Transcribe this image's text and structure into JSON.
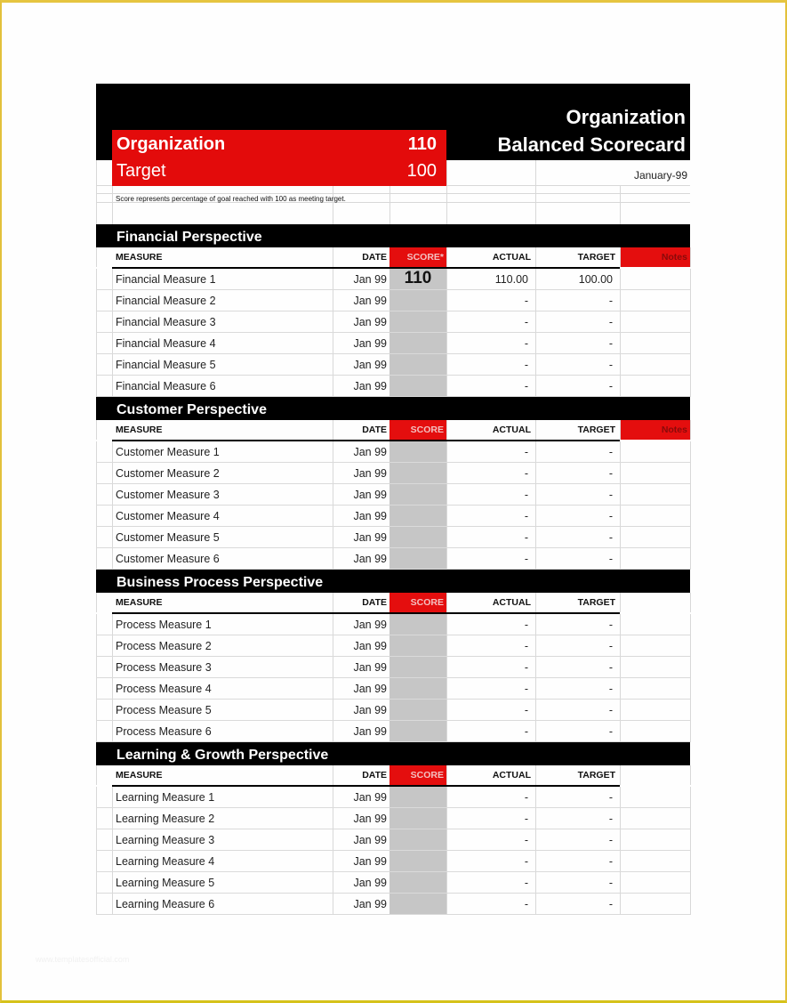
{
  "header": {
    "title_line1": "Organization",
    "title_line2": "Balanced Scorecard",
    "date": "January-99",
    "summary": [
      {
        "label": "Organization",
        "value": "110"
      },
      {
        "label": "Target",
        "value": "100"
      }
    ],
    "note": "Score represents percentage of goal reached with 100 as meeting target."
  },
  "colors": {
    "accent_red": "#e30b0b",
    "band_black": "#000000",
    "score_fill": "#c6c6c6",
    "frame_yellow": "#e3c13b"
  },
  "columns": {
    "measure": "MEASURE",
    "date": "DATE",
    "score": "SCORE",
    "score_first": "SCORE*",
    "actual": "ACTUAL",
    "target": "TARGET",
    "notes": "Notes"
  },
  "sections": [
    {
      "title": "Financial Perspective",
      "score_header": "SCORE*",
      "has_notes": true,
      "rows": [
        {
          "measure": "Financial Measure 1",
          "date": "Jan 99",
          "score": "110",
          "actual": "110.00",
          "target": "100.00"
        },
        {
          "measure": "Financial Measure 2",
          "date": "Jan 99",
          "score": "",
          "actual": "-",
          "target": "-"
        },
        {
          "measure": "Financial Measure 3",
          "date": "Jan 99",
          "score": "",
          "actual": "-",
          "target": "-"
        },
        {
          "measure": "Financial Measure 4",
          "date": "Jan 99",
          "score": "",
          "actual": "-",
          "target": "-"
        },
        {
          "measure": "Financial Measure 5",
          "date": "Jan 99",
          "score": "",
          "actual": "-",
          "target": "-"
        },
        {
          "measure": "Financial Measure 6",
          "date": "Jan 99",
          "score": "",
          "actual": "-",
          "target": "-"
        }
      ]
    },
    {
      "title": "Customer Perspective",
      "score_header": "SCORE",
      "has_notes": true,
      "rows": [
        {
          "measure": "Customer Measure 1",
          "date": "Jan 99",
          "score": "",
          "actual": "-",
          "target": "-"
        },
        {
          "measure": "Customer Measure 2",
          "date": "Jan 99",
          "score": "",
          "actual": "-",
          "target": "-"
        },
        {
          "measure": "Customer Measure 3",
          "date": "Jan 99",
          "score": "",
          "actual": "-",
          "target": "-"
        },
        {
          "measure": "Customer Measure 4",
          "date": "Jan 99",
          "score": "",
          "actual": "-",
          "target": "-"
        },
        {
          "measure": "Customer Measure 5",
          "date": "Jan 99",
          "score": "",
          "actual": "-",
          "target": "-"
        },
        {
          "measure": "Customer Measure 6",
          "date": "Jan 99",
          "score": "",
          "actual": "-",
          "target": "-"
        }
      ]
    },
    {
      "title": "Business Process Perspective",
      "score_header": "SCORE",
      "has_notes": false,
      "rows": [
        {
          "measure": "Process Measure 1",
          "date": "Jan 99",
          "score": "",
          "actual": "-",
          "target": "-"
        },
        {
          "measure": "Process Measure 2",
          "date": "Jan 99",
          "score": "",
          "actual": "-",
          "target": "-"
        },
        {
          "measure": "Process Measure 3",
          "date": "Jan 99",
          "score": "",
          "actual": "-",
          "target": "-"
        },
        {
          "measure": "Process Measure 4",
          "date": "Jan 99",
          "score": "",
          "actual": "-",
          "target": "-"
        },
        {
          "measure": "Process Measure 5",
          "date": "Jan 99",
          "score": "",
          "actual": "-",
          "target": "-"
        },
        {
          "measure": "Process Measure 6",
          "date": "Jan 99",
          "score": "",
          "actual": "-",
          "target": "-"
        }
      ]
    },
    {
      "title": "Learning & Growth Perspective",
      "score_header": "SCORE",
      "has_notes": false,
      "rows": [
        {
          "measure": "Learning Measure 1",
          "date": "Jan 99",
          "score": "",
          "actual": "-",
          "target": "-"
        },
        {
          "measure": "Learning Measure 2",
          "date": "Jan 99",
          "score": "",
          "actual": "-",
          "target": "-"
        },
        {
          "measure": "Learning Measure 3",
          "date": "Jan 99",
          "score": "",
          "actual": "-",
          "target": "-"
        },
        {
          "measure": "Learning Measure 4",
          "date": "Jan 99",
          "score": "",
          "actual": "-",
          "target": "-"
        },
        {
          "measure": "Learning Measure 5",
          "date": "Jan 99",
          "score": "",
          "actual": "-",
          "target": "-"
        },
        {
          "measure": "Learning Measure 6",
          "date": "Jan 99",
          "score": "",
          "actual": "-",
          "target": "-"
        }
      ]
    }
  ]
}
